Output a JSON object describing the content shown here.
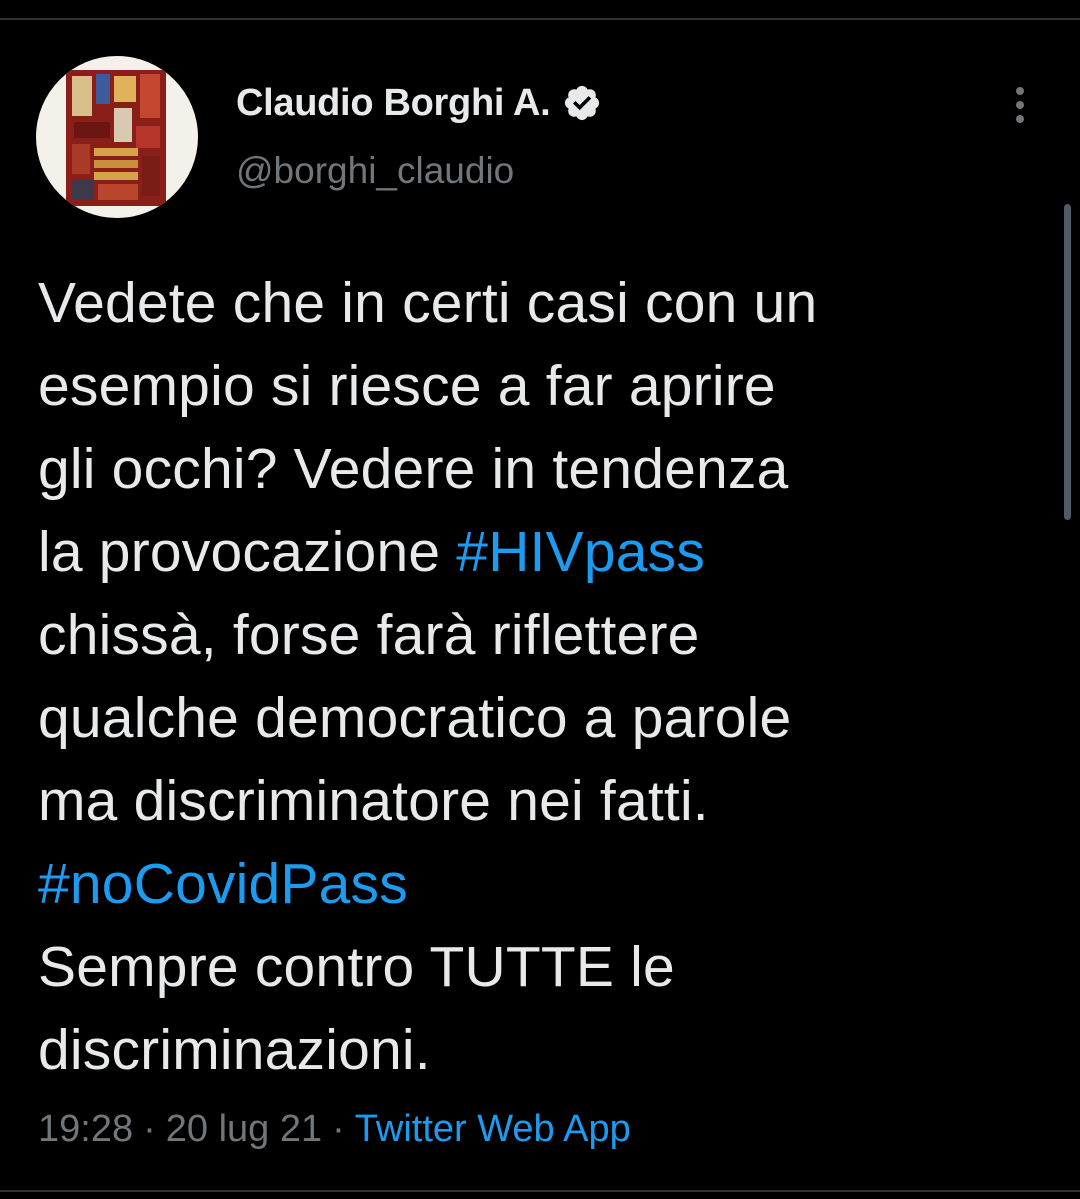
{
  "author": {
    "name": "Claudio Borghi A.",
    "handle": "@borghi_claudio",
    "verified_icon": "verified-badge-icon"
  },
  "menu": {
    "icon": "more-vertical-icon"
  },
  "tweet": {
    "lines": [
      [
        {
          "text": "Vedete che in certi casi con un",
          "type": "text"
        }
      ],
      [
        {
          "text": "esempio si riesce a far aprire",
          "type": "text"
        }
      ],
      [
        {
          "text": "gli occhi? Vedere in tendenza",
          "type": "text"
        }
      ],
      [
        {
          "text": "la provocazione ",
          "type": "text"
        },
        {
          "text": "#HIVpass",
          "type": "hashtag"
        }
      ],
      [
        {
          "text": "chissà, forse farà riflettere",
          "type": "text"
        }
      ],
      [
        {
          "text": "qualche democratico a parole",
          "type": "text"
        }
      ],
      [
        {
          "text": "ma discriminatore nei fatti.",
          "type": "text"
        }
      ],
      [
        {
          "text": "#noCovidPass",
          "type": "hashtag"
        }
      ],
      [
        {
          "text": "Sempre contro TUTTE le",
          "type": "text"
        }
      ],
      [
        {
          "text": "discriminazioni.",
          "type": "text"
        }
      ]
    ]
  },
  "meta": {
    "time": "19:28",
    "separator": "·",
    "date": "20 lug 21",
    "source": "Twitter Web App"
  },
  "colors": {
    "background": "#000000",
    "text": "#e7e9ea",
    "secondary": "#71767b",
    "link": "#1d9bf0"
  }
}
